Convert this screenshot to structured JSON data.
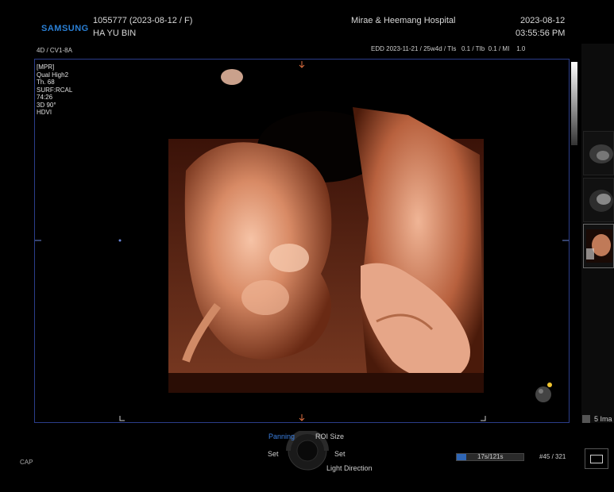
{
  "brand": {
    "logo_text": "SAMSUNG",
    "logo_color": "#2a7fd4"
  },
  "patient": {
    "id_line": "1055777 (2023-08-12 / F)",
    "name": "HA YU BIN"
  },
  "hospital": "Mirae & Heemang Hospital",
  "datetime": {
    "date": "2023-08-12",
    "time": "03:55:56 PM"
  },
  "probe": "4D / CV1-8A",
  "exam_line": "EDD 2023-11-21 / 25w4d / TIs   0.1 / TIb  0.1 / MI    1.0",
  "mpr_info": [
    "[MPR]",
    "Qual High2",
    "Th. 68",
    "SURF:RCAL",
    "74:26",
    "3D 90°",
    "HDVI"
  ],
  "controls": {
    "panning": "Panning",
    "roi_size": "ROI Size",
    "set_left": "Set",
    "set_right": "Set",
    "light_direction": "Light Direction"
  },
  "progress": {
    "text": "17s/121s",
    "fraction": 0.14
  },
  "frame_counter": "#45 / 321",
  "image_count": "5 Ima",
  "cap_label": "CAP",
  "accent_color": "#2f66b5"
}
